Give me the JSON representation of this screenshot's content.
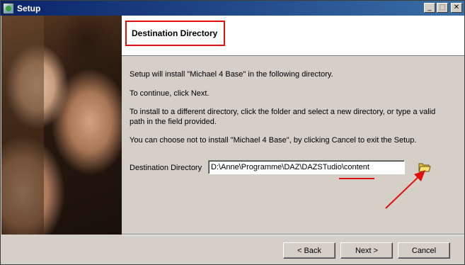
{
  "window": {
    "title": "Setup",
    "controls": [
      "minimize-icon",
      "maximize-icon",
      "close-icon"
    ]
  },
  "header": {
    "title": "Destination Directory"
  },
  "body": {
    "line1": "Setup will install \"Michael 4 Base\" in the following directory.",
    "line2": "To continue, click Next.",
    "line3": "To install to a different directory, click the folder and select a new directory, or type a valid path in the field provided.",
    "line4": "You can choose not to install \"Michael 4 Base\", by clicking Cancel to exit the Setup."
  },
  "destination": {
    "label": "Destination Directory",
    "value": "D:\\Anne\\Programme\\DAZ\\DAZSTudio\\content",
    "browse_icon": "folder-open-icon"
  },
  "buttons": {
    "back": "< Back",
    "next": "Next >",
    "cancel": "Cancel"
  },
  "colors": {
    "annotation": "#e01010",
    "titlebar_start": "#0a246a",
    "titlebar_end": "#3a6ea5"
  }
}
